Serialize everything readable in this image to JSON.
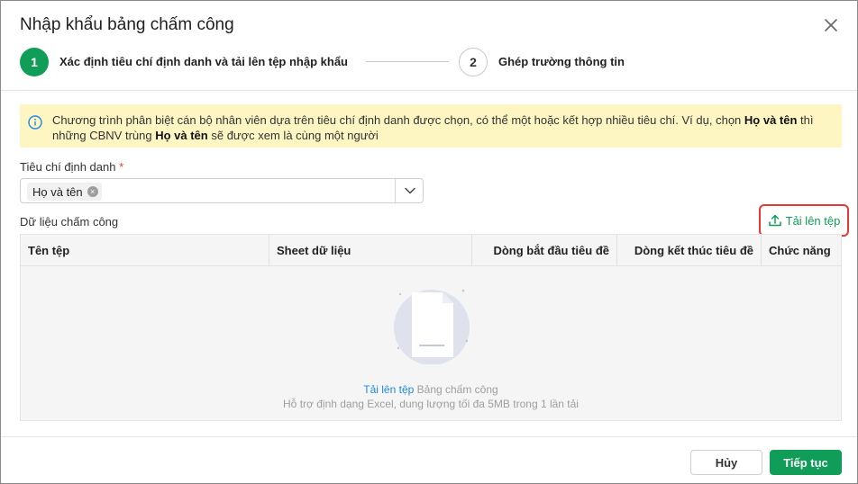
{
  "dialog": {
    "title": "Nhập khẩu bảng chấm công",
    "close_icon": "close-icon"
  },
  "stepper": {
    "steps": [
      {
        "number": "1",
        "label": "Xác định tiêu chí định danh và tải lên tệp nhập khẩu",
        "state": "active"
      },
      {
        "number": "2",
        "label": "Ghép trường thông tin",
        "state": "inactive"
      }
    ]
  },
  "info": {
    "icon": "info-icon",
    "text_part1": "Chương trình phân biệt cán bộ nhân viên dựa trên tiêu chí định danh được chọn, có thể một hoặc kết hợp nhiều tiêu chí. Ví dụ, chọn ",
    "bold1": "Họ và tên",
    "text_part2": " thì những CBNV trùng ",
    "bold2": "Họ và tên",
    "text_part3": " sẽ được xem là cùng một người"
  },
  "criteria": {
    "label": "Tiêu chí định danh",
    "required_mark": "*",
    "selected_tags": [
      "Họ và tên"
    ],
    "tag_remove": "×"
  },
  "data_section": {
    "label": "Dữ liệu chấm công",
    "upload_button": "Tải lên tệp",
    "upload_icon": "upload-icon"
  },
  "table": {
    "columns": [
      "Tên tệp",
      "Sheet dữ liệu",
      "Dòng bắt đầu tiêu đề",
      "Dòng kết thúc tiêu đề",
      "Chức năng"
    ],
    "rows": [],
    "empty": {
      "link_text": "Tải lên tệp",
      "link_suffix": " Bảng chấm công",
      "hint": "Hỗ trợ định dạng Excel, dung lượng tối đa 5MB trong 1 lần tải"
    }
  },
  "footer": {
    "cancel_label": "Hủy",
    "next_label": "Tiếp tục"
  },
  "colors": {
    "accent": "#0f9d58",
    "info_bg": "#fdf6c3",
    "highlight_border": "#e53935",
    "link": "#1e88e5"
  }
}
